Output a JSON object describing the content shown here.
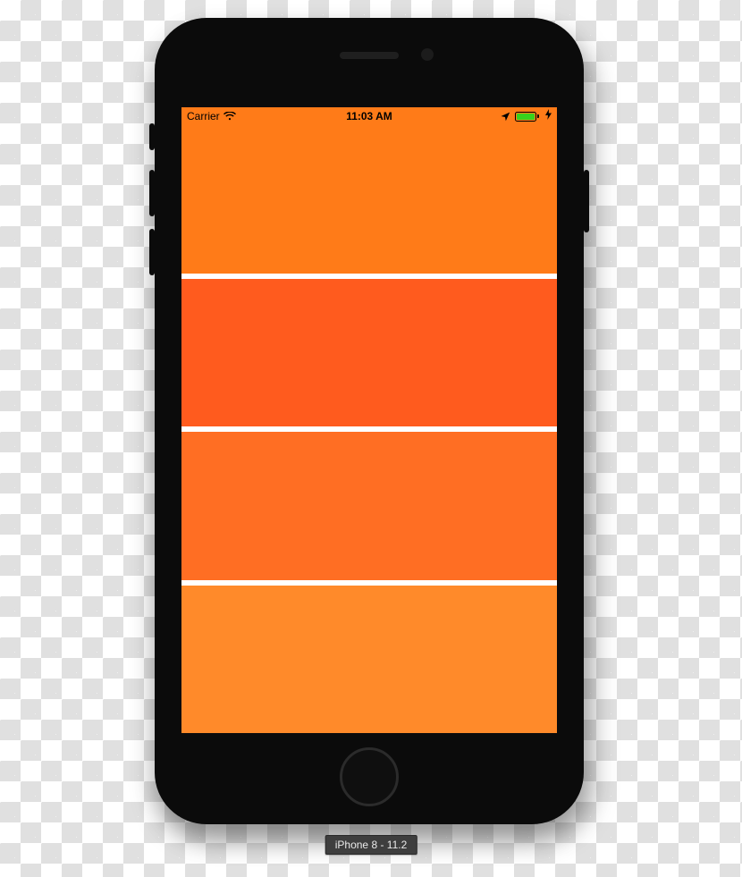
{
  "status_bar": {
    "carrier": "Carrier",
    "time": "11:03 AM",
    "wifi_icon": "wifi-icon",
    "location_icon": "location-arrow-icon",
    "battery_icon": "battery-full-icon",
    "charging_icon": "bolt-icon"
  },
  "rows": [
    {
      "color": "#FF7B18"
    },
    {
      "color": "#FF5B1E"
    },
    {
      "color": "#FF6E23"
    },
    {
      "color": "#FF8A2A"
    }
  ],
  "colors": {
    "device_frame": "#0b0b0b",
    "battery_fill": "#37d21c",
    "row_divider": "#ffffff"
  },
  "caption": "iPhone 8 - 11.2"
}
